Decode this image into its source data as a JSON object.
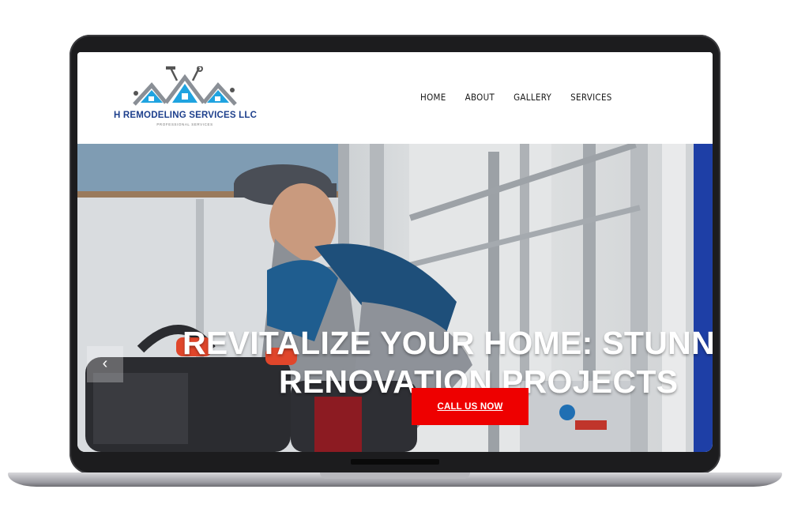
{
  "logo": {
    "name": "H REMODELING SERVICES LLC",
    "tagline": "PROFESSIONAL SERVICES"
  },
  "nav": {
    "items": [
      "HOME",
      "ABOUT",
      "GALLERY",
      "SERVICES"
    ]
  },
  "hero": {
    "title_line1": "REVITALIZE YOUR HOME: STUNNI",
    "title_line2": "RENOVATION PROJECTS",
    "cta_label": "CALL US NOW",
    "prev_arrow": "‹"
  },
  "colors": {
    "brand_blue": "#1d3f8c",
    "roof_blue": "#1fa3e0",
    "cta_red": "#ee0000"
  },
  "icons": [
    "house-roof-logo-icon",
    "hammer-icon",
    "wrench-icon",
    "chevron-left-icon"
  ]
}
